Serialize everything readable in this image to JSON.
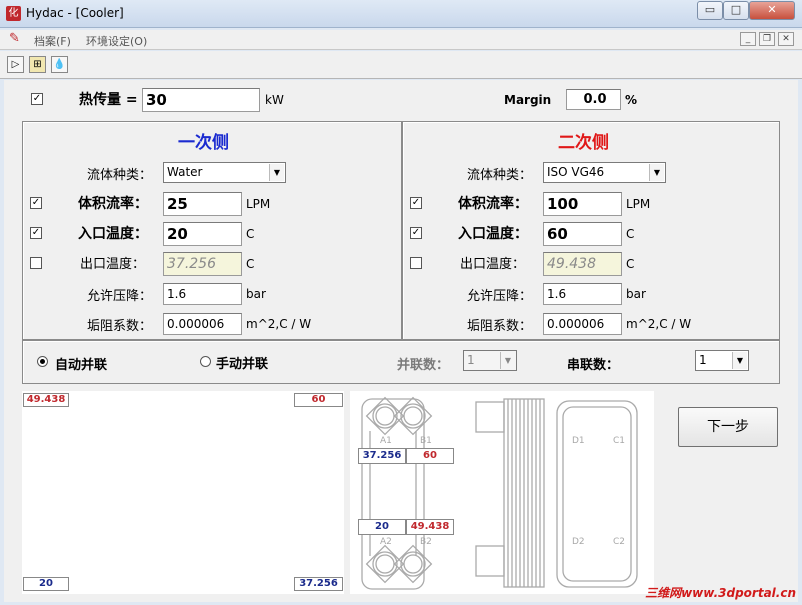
{
  "window": {
    "title": "Hydac - [Cooler]",
    "app_icon_glyph": "化",
    "minimize_glyph": "▭",
    "maximize_glyph": "□",
    "close_glyph": "✕"
  },
  "menu": {
    "items": [
      "档案(F)",
      "环境设定(O)"
    ],
    "mdi_controls": [
      "_",
      "❐",
      "✕"
    ]
  },
  "toolbar": {
    "icons": [
      "play-icon",
      "network-icon",
      "drop-icon"
    ]
  },
  "heat": {
    "checked": true,
    "label": "热传量 =",
    "value": "30",
    "unit": "kW",
    "margin_label": "Margin",
    "margin_value": "0.0",
    "margin_unit": "%"
  },
  "primary": {
    "heading": "一次侧",
    "fluid_label": "流体种类：",
    "fluid_value": "Water",
    "flow_label": "体积流率：",
    "flow_value": "25",
    "flow_unit": "LPM",
    "flow_checked": true,
    "inlet_label": "入口温度：",
    "inlet_value": "20",
    "inlet_unit": "C",
    "inlet_checked": true,
    "outlet_label": "出口温度：",
    "outlet_value": "37.256",
    "outlet_unit": "C",
    "outlet_checked": false,
    "dp_label": "允许压降：",
    "dp_value": "1.6",
    "dp_unit": "bar",
    "fouling_label": "垢阻系数：",
    "fouling_value": "0.000006",
    "fouling_unit": "m^2,C / W"
  },
  "secondary": {
    "heading": "二次侧",
    "fluid_label": "流体种类：",
    "fluid_value": "ISO VG46",
    "flow_label": "体积流率：",
    "flow_value": "100",
    "flow_unit": "LPM",
    "flow_checked": true,
    "inlet_label": "入口温度：",
    "inlet_value": "60",
    "inlet_unit": "C",
    "inlet_checked": true,
    "outlet_label": "出口温度：",
    "outlet_value": "49.438",
    "outlet_unit": "C",
    "outlet_checked": false,
    "dp_label": "允许压降：",
    "dp_value": "1.6",
    "dp_unit": "bar",
    "fouling_label": "垢阻系数：",
    "fouling_value": "0.000006",
    "fouling_unit": "m^2,C / W"
  },
  "arrangement": {
    "auto_label": "自动并联",
    "auto_selected": true,
    "manual_label": "手动并联",
    "manual_selected": false,
    "parallel_label": "并联数：",
    "parallel_value": "1",
    "series_label": "串联数：",
    "series_value": "1"
  },
  "temp_plot": {
    "top_left": "49.438",
    "top_right": "60",
    "bottom_left": "20",
    "bottom_right": "37.256"
  },
  "exchanger": {
    "ports": [
      "A1",
      "B1",
      "A2",
      "B2",
      "D1",
      "C1",
      "D2",
      "C2"
    ],
    "a1_value": "37.256",
    "b1_value": "60",
    "a2_value": "20",
    "b2_value": "49.438"
  },
  "next_button": "下一步",
  "watermark": "三维网www.3dportal.cn",
  "colors": {
    "primary_heading": "#1b2bd0",
    "secondary_heading": "#e01818",
    "cold_value": "#1b2b8c",
    "hot_value": "#c0282d"
  }
}
